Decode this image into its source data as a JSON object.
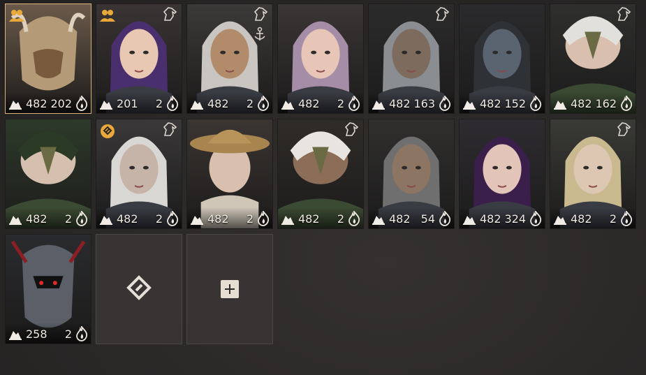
{
  "characters": [
    {
      "level": "482",
      "count": "202",
      "family_badge": true,
      "horse_badge": false,
      "anchor_badge": false,
      "emblem_badge": false,
      "selected": true,
      "tone": "#9a7a55",
      "hair": "#8a6b4a",
      "theme": "helm"
    },
    {
      "level": "201",
      "count": "2",
      "family_badge": true,
      "horse_badge": true,
      "anchor_badge": false,
      "emblem_badge": false,
      "selected": false,
      "tone": "#e8c7b3",
      "hair": "#4a2f6e",
      "theme": "girl"
    },
    {
      "level": "482",
      "count": "2",
      "family_badge": false,
      "horse_badge": true,
      "anchor_badge": true,
      "emblem_badge": false,
      "selected": false,
      "tone": "#b28c6a",
      "hair": "#c9c6c2",
      "theme": "elf"
    },
    {
      "level": "482",
      "count": "2",
      "family_badge": false,
      "horse_badge": false,
      "anchor_badge": false,
      "emblem_badge": false,
      "selected": false,
      "tone": "#e7c6b8",
      "hair": "#a58da8",
      "theme": "girl"
    },
    {
      "level": "482",
      "count": "163",
      "family_badge": false,
      "horse_badge": true,
      "anchor_badge": false,
      "emblem_badge": false,
      "selected": false,
      "tone": "#7d6b5e",
      "hair": "#8a8d91",
      "theme": "man"
    },
    {
      "level": "482",
      "count": "152",
      "family_badge": false,
      "horse_badge": false,
      "anchor_badge": false,
      "emblem_badge": false,
      "selected": false,
      "tone": "#5a6470",
      "hair": "#2e3236",
      "theme": "dark"
    },
    {
      "level": "482",
      "count": "162",
      "family_badge": false,
      "horse_badge": true,
      "anchor_badge": false,
      "emblem_badge": false,
      "selected": false,
      "tone": "#d9bfae",
      "hair": "#e2e0dc",
      "theme": "owl"
    },
    {
      "level": "482",
      "count": "2",
      "family_badge": false,
      "horse_badge": false,
      "anchor_badge": false,
      "emblem_badge": false,
      "selected": false,
      "tone": "#d5bfaf",
      "hair": "#2a3a24",
      "theme": "owl"
    },
    {
      "level": "482",
      "count": "2",
      "family_badge": false,
      "horse_badge": true,
      "anchor_badge": false,
      "emblem_badge": true,
      "selected": false,
      "tone": "#c7b4a8",
      "hair": "#d9d7d4",
      "theme": "girl"
    },
    {
      "level": "482",
      "count": "2",
      "family_badge": false,
      "horse_badge": false,
      "anchor_badge": false,
      "emblem_badge": false,
      "selected": false,
      "tone": "#d8bfae",
      "hair": "#b4925e",
      "theme": "hat"
    },
    {
      "level": "482",
      "count": "2",
      "family_badge": false,
      "horse_badge": true,
      "anchor_badge": false,
      "emblem_badge": false,
      "selected": false,
      "tone": "#8c6e58",
      "hair": "#e8e4df",
      "theme": "owl"
    },
    {
      "level": "482",
      "count": "54",
      "family_badge": false,
      "horse_badge": false,
      "anchor_badge": false,
      "emblem_badge": false,
      "selected": false,
      "tone": "#8d7563",
      "hair": "#6f6f6f",
      "theme": "man"
    },
    {
      "level": "482",
      "count": "324",
      "family_badge": false,
      "horse_badge": false,
      "anchor_badge": false,
      "emblem_badge": false,
      "selected": false,
      "tone": "#e3c4b8",
      "hair": "#3a1f4a",
      "theme": "girl"
    },
    {
      "level": "482",
      "count": "2",
      "family_badge": false,
      "horse_badge": true,
      "anchor_badge": false,
      "emblem_badge": false,
      "selected": false,
      "tone": "#dcc7b2",
      "hair": "#c8b98f",
      "theme": "elf"
    },
    {
      "level": "258",
      "count": "2",
      "family_badge": false,
      "horse_badge": false,
      "anchor_badge": false,
      "emblem_badge": false,
      "selected": false,
      "tone": "#444a52",
      "hair": "#8b1f24",
      "theme": "knight"
    }
  ],
  "empty_slots": [
    {
      "icon": "emblem-icon"
    },
    {
      "icon": "plus-icon"
    }
  ],
  "colors": {
    "accent": "#d9b27a",
    "badge": "#e8a93a"
  }
}
